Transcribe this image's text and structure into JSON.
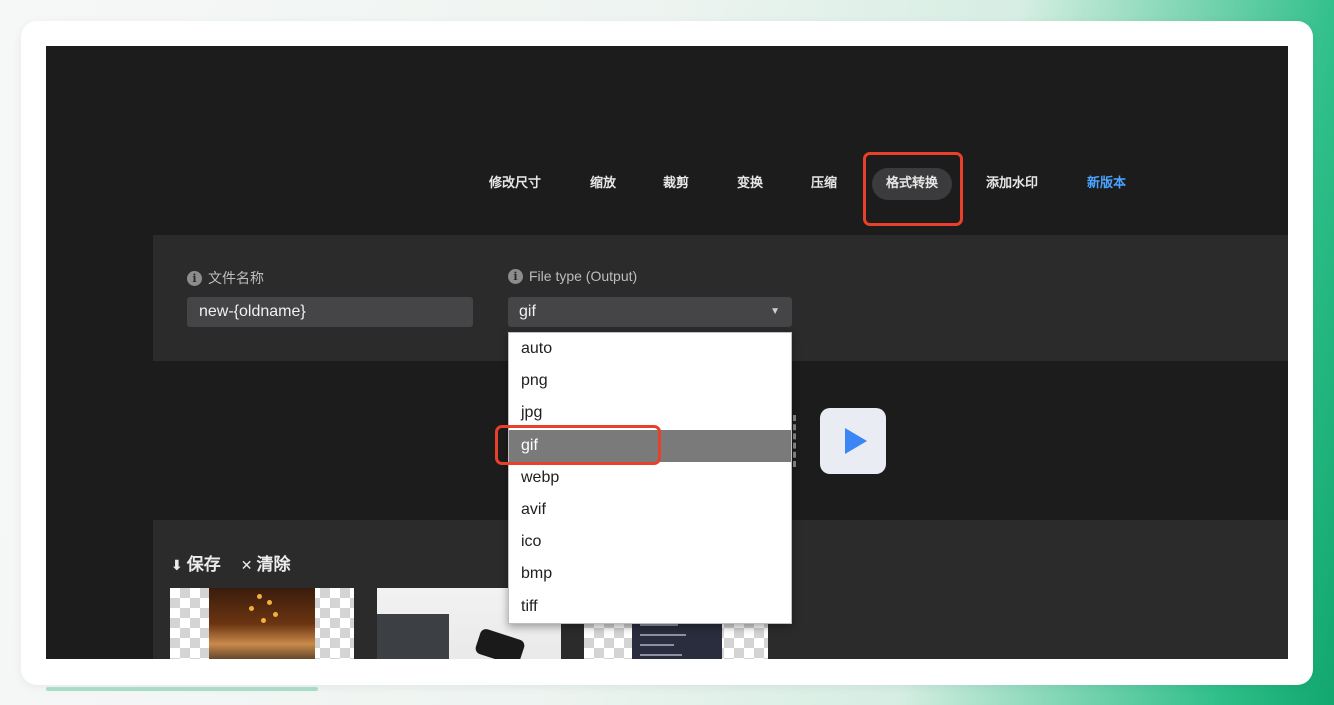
{
  "nav": {
    "items": [
      {
        "label": "修改尺寸"
      },
      {
        "label": "缩放"
      },
      {
        "label": "裁剪"
      },
      {
        "label": "变换"
      },
      {
        "label": "压缩"
      },
      {
        "label": "格式转换",
        "active": true
      },
      {
        "label": "添加水印"
      },
      {
        "label": "新版本",
        "accent": "#4aa3ff"
      }
    ]
  },
  "options": {
    "filename": {
      "label": "文件名称",
      "value": "new-{oldname}"
    },
    "filetype": {
      "label": "File type (Output)",
      "value": "gif"
    }
  },
  "dropdown": {
    "options": [
      "auto",
      "png",
      "jpg",
      "gif",
      "webp",
      "avif",
      "ico",
      "bmp",
      "tiff"
    ],
    "selected": "gif"
  },
  "results": {
    "save_label": "保存",
    "clear_label": "清除"
  },
  "colors": {
    "highlight": "#e8402a",
    "play": "#3a86f6",
    "background": "#1c1c1d"
  }
}
